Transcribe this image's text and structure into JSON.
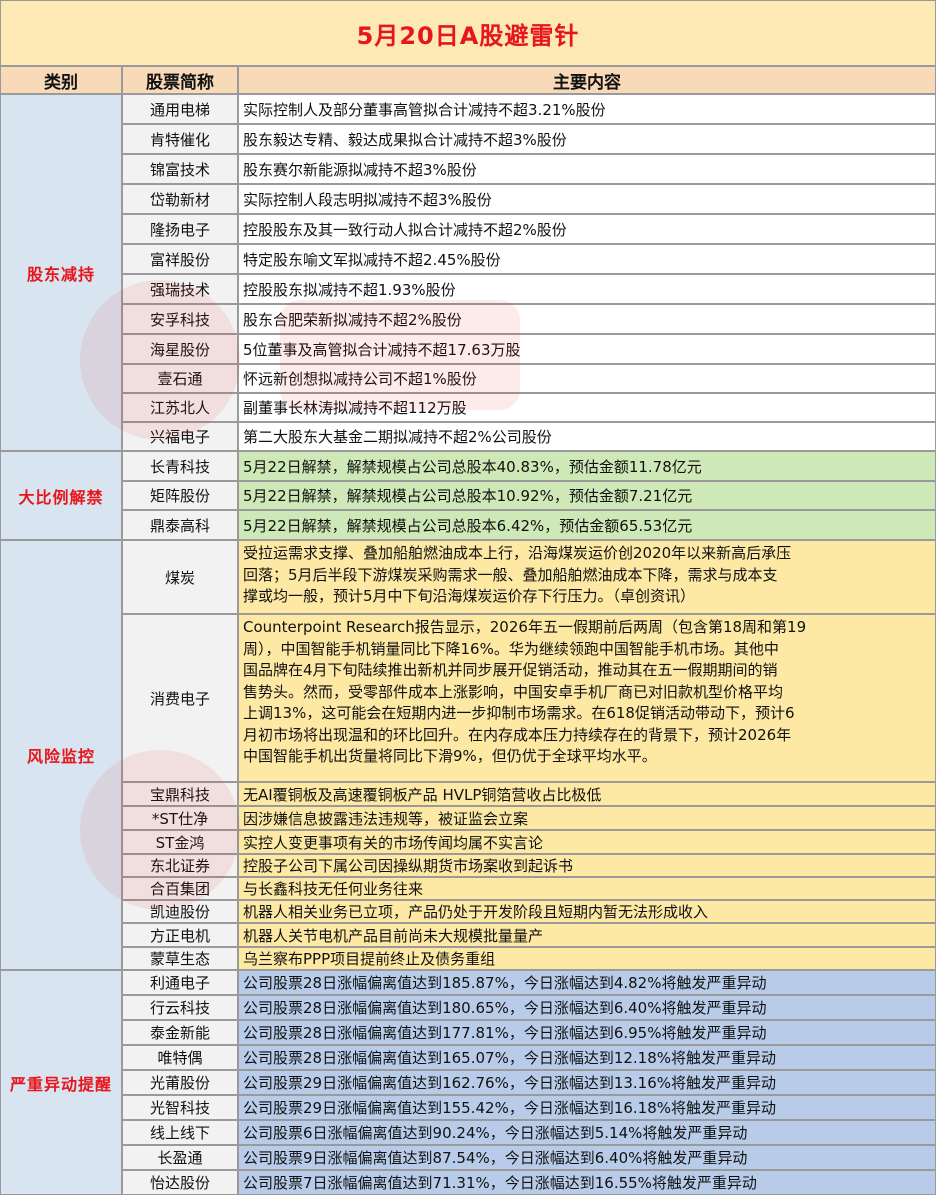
{
  "title": "5月20日A股避雷针",
  "headers": {
    "category": "类别",
    "stock": "股票简称",
    "content": "主要内容"
  },
  "colors": {
    "title_bg": "#fce9b4",
    "title_text": "#e8161c",
    "header_bg": "#f8d9b8",
    "category_bg": "#d8e4f0",
    "name_bg": "#f2f2f2",
    "reduction_bg": "#ffffff",
    "unlock_bg": "#cfe8b8",
    "risk_bg": "#fde9a3",
    "abnormal_bg": "#b8cce9"
  },
  "sections": [
    {
      "category": "股东减持",
      "rows": [
        {
          "stock": "通用电梯",
          "content": "实际控制人及部分董事高管拟合计减持不超3.21%股份"
        },
        {
          "stock": "肯特催化",
          "content": "股东毅达专精、毅达成果拟合计减持不超3%股份"
        },
        {
          "stock": "锦富技术",
          "content": "股东赛尔新能源拟减持不超3%股份"
        },
        {
          "stock": "岱勒新材",
          "content": "实际控制人段志明拟减持不超3%股份"
        },
        {
          "stock": "隆扬电子",
          "content": "控股股东及其一致行动人拟合计减持不超2%股份"
        },
        {
          "stock": "富祥股份",
          "content": "特定股东喻文军拟减持不超2.45%股份"
        },
        {
          "stock": "强瑞技术",
          "content": "控股股东拟减持不超1.93%股份"
        },
        {
          "stock": "安孚科技",
          "content": "股东合肥荣新拟减持不超2%股份"
        },
        {
          "stock": "海星股份",
          "content": "5位董事及高管拟合计减持不超17.63万股"
        },
        {
          "stock": "壹石通",
          "content": "怀远新创想拟减持公司不超1%股份"
        },
        {
          "stock": "江苏北人",
          "content": "副董事长林涛拟减持不超112万股"
        },
        {
          "stock": "兴福电子",
          "content": "第二大股东大基金二期拟减持不超2%公司股份"
        }
      ]
    },
    {
      "category": "大比例解禁",
      "rows": [
        {
          "stock": "长青科技",
          "content": "5月22日解禁，解禁规模占公司总股本40.83%，预估金额11.78亿元"
        },
        {
          "stock": "矩阵股份",
          "content": "5月22日解禁，解禁规模占公司总股本10.92%，预估金额7.21亿元"
        },
        {
          "stock": "鼎泰高科",
          "content": "5月22日解禁，解禁规模占公司总股本6.42%，预估金额65.53亿元"
        }
      ]
    },
    {
      "category": "风险监控",
      "rows": [
        {
          "stock": "煤炭",
          "lines": [
            "受拉运需求支撑、叠加船舶燃油成本上行，沿海煤炭运价创2020年以来新高后承压",
            "回落；5月后半段下游煤炭采购需求一般、叠加船舶燃油成本下降，需求与成本支",
            "撑或均一般，预计5月中下旬沿海煤炭运价存下行压力。（卓创资讯）"
          ]
        },
        {
          "stock": "消费电子",
          "lines": [
            "Counterpoint Research报告显示，2026年五一假期前后两周（包含第18周和第19",
            "周），中国智能手机销量同比下降16%。华为继续领跑中国智能手机市场。其他中",
            "国品牌在4月下旬陆续推出新机并同步展开促销活动，推动其在五一假期期间的销",
            "售势头。然而，受零部件成本上涨影响，中国安卓手机厂商已对旧款机型价格平均",
            "上调13%，这可能会在短期内进一步抑制市场需求。在618促销活动带动下，预计6",
            "月初市场将出现温和的环比回升。在内存成本压力持续存在的背景下，预计2026年",
            "中国智能手机出货量将同比下滑9%，但仍优于全球平均水平。"
          ]
        },
        {
          "stock": "宝鼎科技",
          "content": "无AI覆铜板及高速覆铜板产品 HVLP铜箔营收占比极低"
        },
        {
          "stock": "*ST仕净",
          "content": "因涉嫌信息披露违法违规等，被证监会立案"
        },
        {
          "stock": "ST金鸿",
          "content": "实控人变更事项有关的市场传闻均属不实言论"
        },
        {
          "stock": "东北证券",
          "content": "控股子公司下属公司因操纵期货市场案收到起诉书"
        },
        {
          "stock": "合百集团",
          "content": "与长鑫科技无任何业务往来"
        },
        {
          "stock": "凯迪股份",
          "content": "机器人相关业务已立项，产品仍处于开发阶段且短期内暂无法形成收入"
        },
        {
          "stock": "方正电机",
          "content": "机器人关节电机产品目前尚未大规模批量量产"
        },
        {
          "stock": "蒙草生态",
          "content": "乌兰察布PPP项目提前终止及债务重组"
        }
      ]
    },
    {
      "category": "严重异动提醒",
      "rows": [
        {
          "stock": "利通电子",
          "content": "公司股票28日涨幅偏离值达到185.87%，今日涨幅达到4.82%将触发严重异动"
        },
        {
          "stock": "行云科技",
          "content": "公司股票28日涨幅偏离值达到180.65%，今日涨幅达到6.40%将触发严重异动"
        },
        {
          "stock": "泰金新能",
          "content": "公司股票28日涨幅偏离值达到177.81%，今日涨幅达到6.95%将触发严重异动"
        },
        {
          "stock": "唯特偶",
          "content": "公司股票28日涨幅偏离值达到165.07%，今日涨幅达到12.18%将触发严重异动"
        },
        {
          "stock": "光莆股份",
          "content": "公司股票29日涨幅偏离值达到162.76%，今日涨幅达到13.16%将触发严重异动"
        },
        {
          "stock": "光智科技",
          "content": "公司股票29日涨幅偏离值达到155.42%，今日涨幅达到16.18%将触发严重异动"
        },
        {
          "stock": "线上线下",
          "content": "公司股票6日涨幅偏离值达到90.24%，今日涨幅达到5.14%将触发严重异动"
        },
        {
          "stock": "长盈通",
          "content": "公司股票9日涨幅偏离值达到87.54%，今日涨幅达到6.40%将触发严重异动"
        },
        {
          "stock": "怡达股份",
          "content": "公司股票7日涨幅偏离值达到71.31%，今日涨幅达到16.55%将触发严重异动"
        }
      ]
    }
  ]
}
